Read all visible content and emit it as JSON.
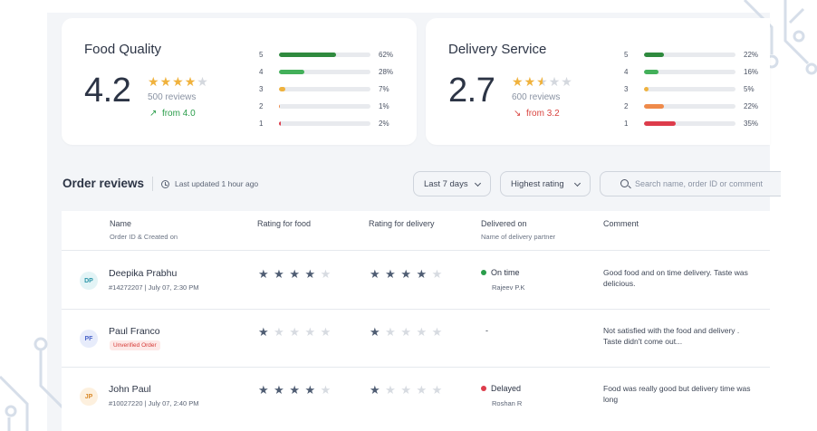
{
  "summary": {
    "food": {
      "title": "Food Quality",
      "score": "4.2",
      "stars_filled": 4,
      "stars_half": 0,
      "reviews": "500 reviews",
      "trend": "from 4.0",
      "trend_direction": "up",
      "distribution": [
        {
          "star": "5",
          "pct": "62%",
          "fill": 0.62,
          "color": "#2f8a3e"
        },
        {
          "star": "4",
          "pct": "28%",
          "fill": 0.28,
          "color": "#43b05a"
        },
        {
          "star": "3",
          "pct": "7%",
          "fill": 0.07,
          "color": "#efb23e"
        },
        {
          "star": "2",
          "pct": "1%",
          "fill": 0.01,
          "color": "#ef8a4a"
        },
        {
          "star": "1",
          "pct": "2%",
          "fill": 0.02,
          "color": "#dd3c4b"
        }
      ]
    },
    "delivery": {
      "title": "Delivery Service",
      "score": "2.7",
      "stars_filled": 2,
      "stars_half": 1,
      "reviews": "600 reviews",
      "trend": "from 3.2",
      "trend_direction": "down",
      "distribution": [
        {
          "star": "5",
          "pct": "22%",
          "fill": 0.22,
          "color": "#2f8a3e"
        },
        {
          "star": "4",
          "pct": "16%",
          "fill": 0.16,
          "color": "#43b05a"
        },
        {
          "star": "3",
          "pct": "5%",
          "fill": 0.05,
          "color": "#efb23e"
        },
        {
          "star": "2",
          "pct": "22%",
          "fill": 0.22,
          "color": "#ef8a4a"
        },
        {
          "star": "1",
          "pct": "35%",
          "fill": 0.35,
          "color": "#dd3c4b"
        }
      ]
    }
  },
  "reviews_section": {
    "title": "Order reviews",
    "updated": "Last updated 1 hour ago",
    "range_select": "Last 7 days",
    "sort_select": "Highest rating",
    "search_placeholder": "Search name, order ID or comment"
  },
  "table": {
    "headers": {
      "name": "Name",
      "name_sub": "Order ID & Created on",
      "food": "Rating for food",
      "delivery": "Rating for delivery",
      "delivered": "Delivered on",
      "delivered_sub": "Name of delivery partner",
      "comment": "Comment"
    },
    "rows": [
      {
        "initials": "DP",
        "avatar_bg": "#e3f4f6",
        "avatar_fg": "#2a95a8",
        "name": "Deepika Prabhu",
        "meta": "#14272207 | July 07, 2:30 PM",
        "unverified": "",
        "food_rating": 4,
        "delivery_rating": 4,
        "status": "On time",
        "status_color": "#2a9d4a",
        "partner": "Rajeev P.K",
        "comment": "Good food and on time delivery. Taste was delicious."
      },
      {
        "initials": "PF",
        "avatar_bg": "#e7ecfb",
        "avatar_fg": "#4a64c9",
        "name": "Paul Franco",
        "meta": "",
        "unverified": "Unverified Order",
        "food_rating": 1,
        "delivery_rating": 1,
        "status": "-",
        "status_color": "",
        "partner": "",
        "comment": "Not satisfied with the food and delivery . Taste didn't come out..."
      },
      {
        "initials": "JP",
        "avatar_bg": "#fdf0de",
        "avatar_fg": "#d98a2b",
        "name": "John Paul",
        "meta": "#10027220 | July 07, 2:40 PM",
        "unverified": "",
        "food_rating": 4,
        "delivery_rating": 1,
        "status": "Delayed",
        "status_color": "#dd3c4b",
        "partner": "Roshan R",
        "comment": "Food was really good but delivery time was long"
      }
    ]
  }
}
